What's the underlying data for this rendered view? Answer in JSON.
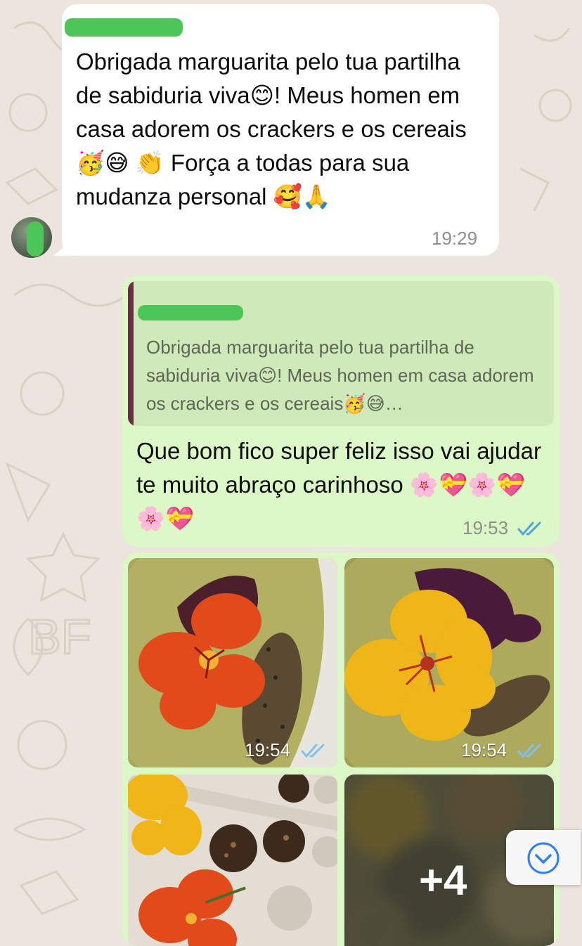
{
  "incoming": {
    "text": "Obrigada marguarita pelo tua partilha de sabiduria viva😊! Meus homen em casa adorem os crackers e os cereais🥳😅 👏 Força a todas para sua mudanza personal 🥰🙏",
    "time": "19:29"
  },
  "outgoing_reply": {
    "quoted_text": "Obrigada marguarita pelo tua partilha de sabiduria viva😊! Meus homen em casa adorem os crackers e os cereais🥳😅…",
    "text": "Que bom fico super feliz isso vai ajudar te muito abraço carinhoso 🌸💝🌸💝🌸💝",
    "time": "19:53"
  },
  "media": {
    "photos": [
      {
        "time": "19:54"
      },
      {
        "time": "19:54"
      }
    ],
    "more_count": "+4"
  },
  "colors": {
    "outgoing_bubble": "#dcf8c6",
    "incoming_bubble": "#ffffff",
    "read_ticks": "#4fa3e0",
    "quote_bar": "#6a2e45",
    "redaction": "#4cc757"
  },
  "icons": {
    "read_receipt": "double-check-icon",
    "scroll_down": "chevron-down-circle-icon"
  }
}
